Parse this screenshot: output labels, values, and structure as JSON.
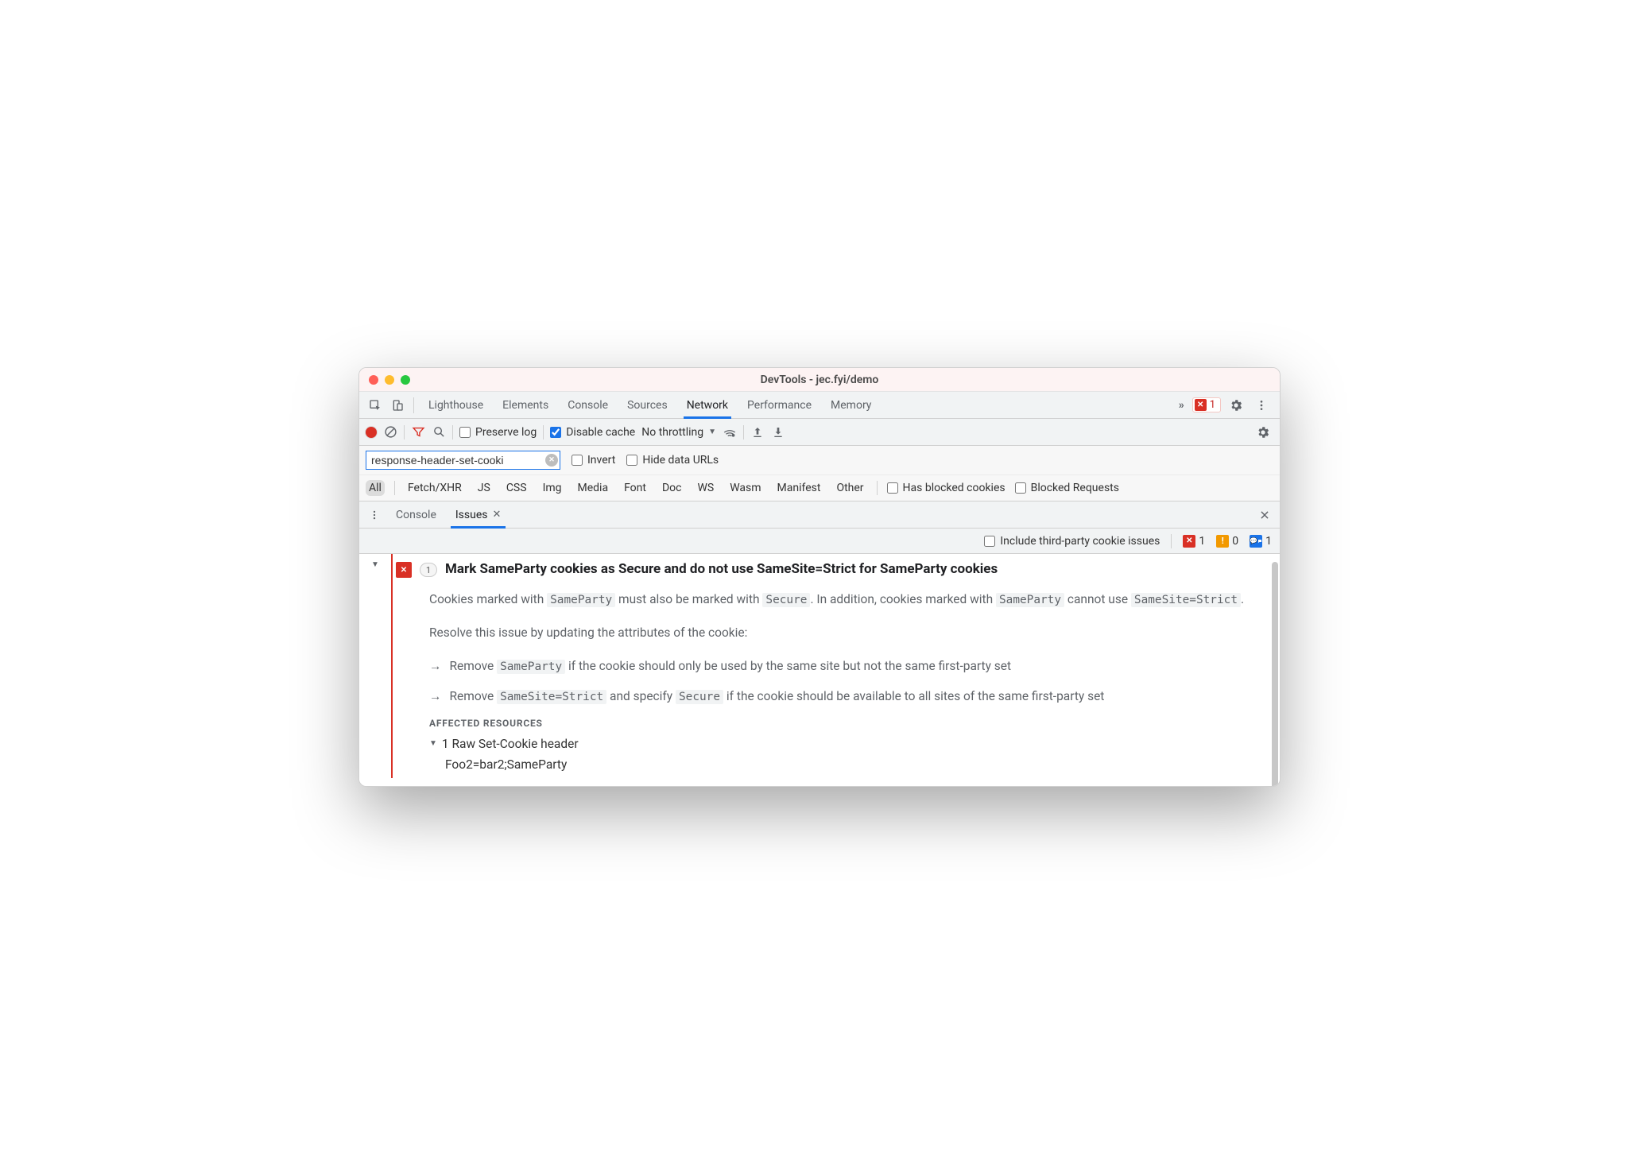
{
  "window": {
    "title": "DevTools - jec.fyi/demo"
  },
  "mainTabs": {
    "items": [
      "Lighthouse",
      "Elements",
      "Console",
      "Sources",
      "Network",
      "Performance",
      "Memory"
    ],
    "active": "Network",
    "overflow": "»",
    "errorCount": "1"
  },
  "netToolbar": {
    "preserveLog": {
      "label": "Preserve log",
      "checked": false
    },
    "disableCache": {
      "label": "Disable cache",
      "checked": true
    },
    "throttling": "No throttling"
  },
  "filterRow": {
    "filterValue": "response-header-set-cooki",
    "invert": {
      "label": "Invert",
      "checked": false
    },
    "hideDataUrls": {
      "label": "Hide data URLs",
      "checked": false
    }
  },
  "typeRow": {
    "types": [
      "All",
      "Fetch/XHR",
      "JS",
      "CSS",
      "Img",
      "Media",
      "Font",
      "Doc",
      "WS",
      "Wasm",
      "Manifest",
      "Other"
    ],
    "active": "All",
    "hasBlockedCookies": {
      "label": "Has blocked cookies",
      "checked": false
    },
    "blockedRequests": {
      "label": "Blocked Requests",
      "checked": false
    }
  },
  "drawerTabs": {
    "items": [
      "Console",
      "Issues"
    ],
    "active": "Issues"
  },
  "issuesBar": {
    "includeThirdParty": {
      "label": "Include third-party cookie issues",
      "checked": false
    },
    "counters": {
      "errors": "1",
      "warnings": "0",
      "info": "1"
    }
  },
  "issue": {
    "count": "1",
    "title": "Mark SameParty cookies as Secure and do not use SameSite=Strict for SameParty cookies",
    "p1_a": "Cookies marked with ",
    "p1_code1": "SameParty",
    "p1_b": " must also be marked with ",
    "p1_code2": "Secure",
    "p1_c": ". In addition, cookies marked with ",
    "p1_code3": "SameParty",
    "p1_d": " cannot use ",
    "p1_code4": "SameSite=Strict",
    "p1_e": ".",
    "p2": "Resolve this issue by updating the attributes of the cookie:",
    "b1_a": "Remove ",
    "b1_code": "SameParty",
    "b1_b": " if the cookie should only be used by the same site but not the same first-party set",
    "b2_a": "Remove ",
    "b2_code1": "SameSite=Strict",
    "b2_b": " and specify ",
    "b2_code2": "Secure",
    "b2_c": " if the cookie should be available to all sites of the same first-party set",
    "affectedTitle": "AFFECTED RESOURCES",
    "affectedRow": "1 Raw Set-Cookie header",
    "affectedValue": "Foo2=bar2;SameParty"
  }
}
